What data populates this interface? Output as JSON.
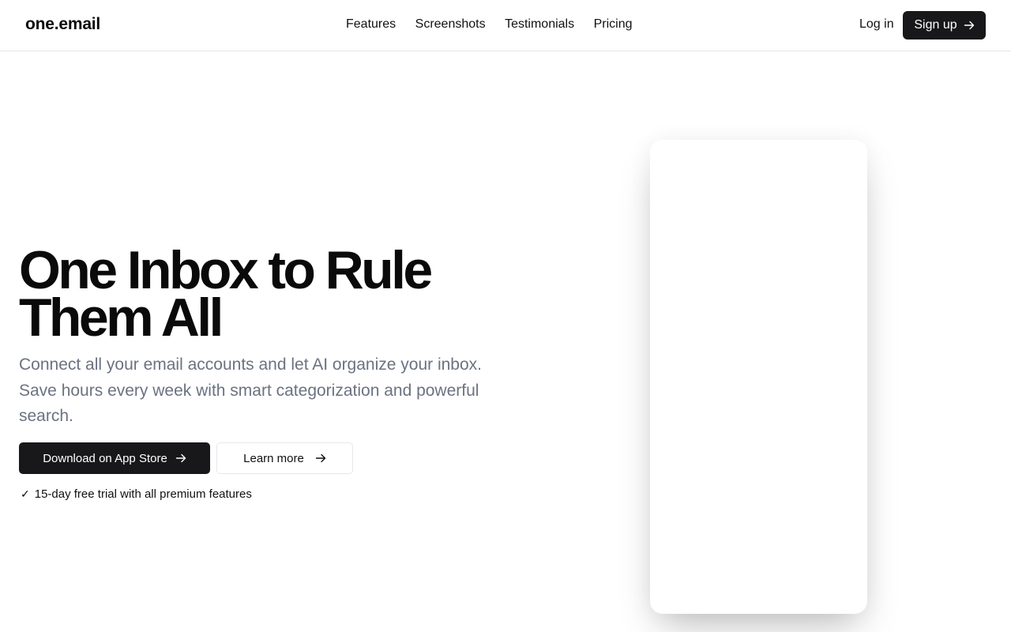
{
  "brand": {
    "logo_text": "one.email"
  },
  "nav": {
    "links": [
      "Features",
      "Screenshots",
      "Testimonials",
      "Pricing"
    ],
    "login_label": "Log in",
    "signup_label": "Sign up"
  },
  "hero": {
    "title_line1": "One Inbox to Rule",
    "title_line2": "Them All",
    "subtitle": "Connect all your email accounts and let AI organize your inbox. Save hours every week with smart categorization and powerful search.",
    "primary_cta": "Download on App Store",
    "secondary_cta": "Learn more",
    "trial_check": "✓",
    "trial_text": "15-day free trial with all premium features"
  },
  "colors": {
    "primary_button_bg": "#18181b",
    "muted_text": "#6b7280",
    "border": "#e5e7eb"
  },
  "icons": [
    "arrow-right-icon",
    "check-icon"
  ]
}
